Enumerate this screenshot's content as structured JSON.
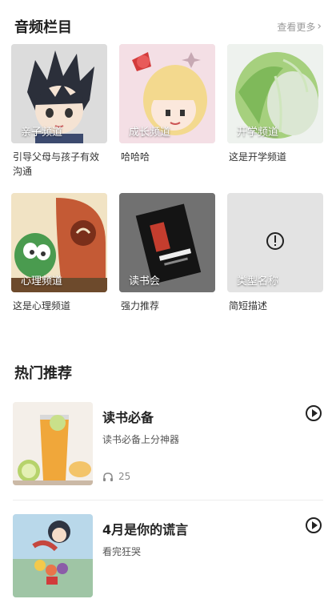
{
  "audio_section": {
    "title": "音频栏目",
    "more_label": "查看更多"
  },
  "channels": [
    {
      "label": "亲子频道",
      "desc": "引导父母与孩子有效沟通",
      "icon": "anime-boy-image"
    },
    {
      "label": "成长频道",
      "desc": "哈哈哈",
      "icon": "anime-girl-image"
    },
    {
      "label": "开学频道",
      "desc": "这是开学频道",
      "icon": "cabbage-image"
    },
    {
      "label": "心理频道",
      "desc": "这是心理频道",
      "icon": "cartoon-illustration-image"
    },
    {
      "label": "读书会",
      "desc": "强力推荐",
      "icon": "book-cover-image"
    },
    {
      "label": "类型名称",
      "desc": "简短描述",
      "icon": "info-placeholder-icon"
    }
  ],
  "hot_section": {
    "title": "热门推荐"
  },
  "recommendations": [
    {
      "title": "读书必备",
      "subtitle": "读书必备上分神器",
      "listens": "25",
      "icon": "iced-tea-image"
    },
    {
      "title": "4月是你的谎言",
      "subtitle": "看完狂哭",
      "listens": "",
      "icon": "anime-poster-image"
    }
  ],
  "colors": {
    "text_primary": "#1f1f1f",
    "text_muted": "#9a9a9a",
    "placeholder_bg": "#e6e6e6"
  }
}
